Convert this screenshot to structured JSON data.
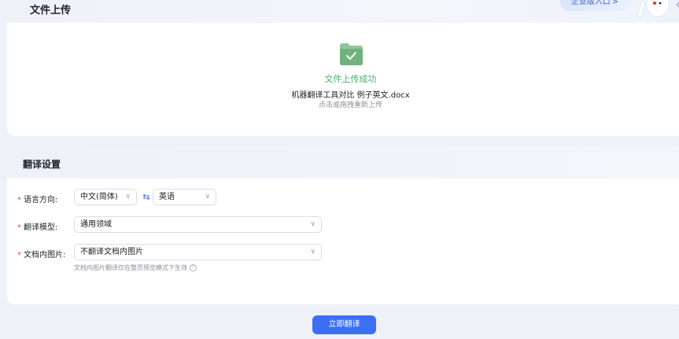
{
  "upload": {
    "title": "文件上传",
    "enterprise_label": "企业版入口",
    "enterprise_arrow": ">",
    "status": "文件上传成功",
    "filename": "机器翻译工具对比 例子英文.docx",
    "hint": "点击或拖拽重新上传"
  },
  "settings": {
    "title": "翻译设置",
    "required_mark": "*",
    "language_label": "语言方向:",
    "source_lang": "中文(简体)",
    "swap_symbol": "⇆",
    "target_lang": "英语",
    "model_label": "翻译模型:",
    "model_value": "通用领域",
    "image_label": "文档内图片:",
    "image_value": "不翻译文档内图片",
    "image_note": "文档内图片翻译仅在整页预览模式下生效",
    "help_symbol": "?"
  },
  "actions": {
    "translate_label": "立即翻译"
  },
  "icons": {
    "chevron": "chevron-down-icon",
    "file": "file-check-icon",
    "swap": "swap-icon",
    "help": "help-icon"
  },
  "colors": {
    "accent": "#3d6ff5",
    "success": "#4caf6a",
    "required": "#e5484d"
  }
}
